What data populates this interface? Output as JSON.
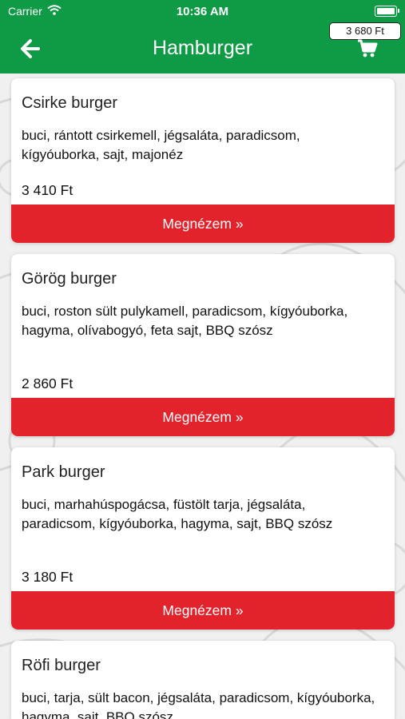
{
  "status_bar": {
    "carrier": "Carrier",
    "time": "10:36 AM"
  },
  "nav": {
    "title": "Hamburger",
    "cart_total": "3 680 Ft"
  },
  "button_label": "Megnézem »",
  "items": [
    {
      "name": "Csirke burger",
      "description": "buci, rántott csirkemell, jégsaláta, paradicsom, kígyóuborka, sajt, majonéz",
      "price": "3 410 Ft"
    },
    {
      "name": "Görög burger",
      "description": "buci, roston sült pulykamell, paradicsom, kígyóuborka, hagyma, olívabogyó, feta sajt, BBQ szósz",
      "price": "2 860 Ft"
    },
    {
      "name": "Park burger",
      "description": "buci, marhahúspogácsa, füstölt tarja, jégsaláta, paradicsom, kígyóuborka, hagyma, sajt, BBQ szósz",
      "price": "3 180 Ft"
    },
    {
      "name": "Röfi burger",
      "description": "buci, tarja, sült bacon, jégsaláta, paradicsom, kígyóuborka, hagyma, sajt, BBQ szósz",
      "price": ""
    }
  ],
  "colors": {
    "header": "#0f9a45",
    "button": "#e2232b",
    "card": "#ffffff"
  }
}
